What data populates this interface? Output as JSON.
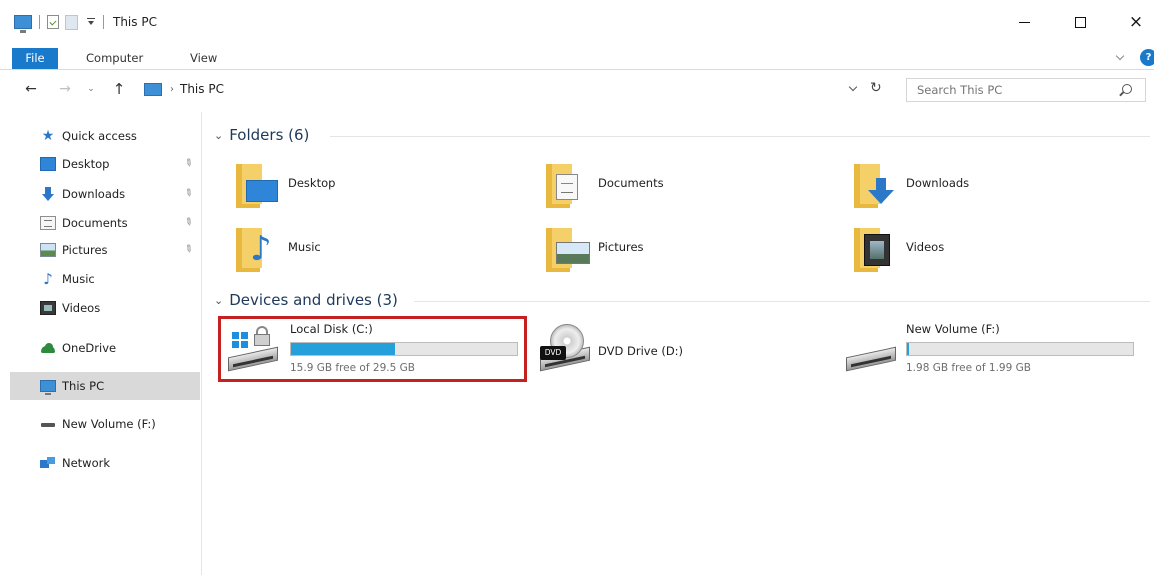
{
  "window": {
    "title": "This PC",
    "close_glyph": "×"
  },
  "ribbon": {
    "tabs": [
      {
        "label": "File",
        "active": true
      },
      {
        "label": "Computer",
        "active": false
      },
      {
        "label": "View",
        "active": false
      }
    ],
    "help_glyph": "?"
  },
  "navigation": {
    "back_glyph": "←",
    "forward_glyph": "→",
    "recent_glyph": "⌄",
    "up_glyph": "↑",
    "breadcrumb": [
      "This PC"
    ],
    "breadcrumb_separator": "›",
    "refresh_glyph": "↻",
    "search_placeholder": "Search This PC"
  },
  "sidebar": {
    "items": [
      {
        "label": "Quick access",
        "icon": "star-icon",
        "pinned": false,
        "selected": false
      },
      {
        "label": "Desktop",
        "icon": "desktop-icon",
        "pinned": true,
        "selected": false
      },
      {
        "label": "Downloads",
        "icon": "download-icon",
        "pinned": true,
        "selected": false
      },
      {
        "label": "Documents",
        "icon": "documents-icon",
        "pinned": true,
        "selected": false
      },
      {
        "label": "Pictures",
        "icon": "pictures-icon",
        "pinned": true,
        "selected": false
      },
      {
        "label": "Music",
        "icon": "music-icon",
        "pinned": false,
        "selected": false
      },
      {
        "label": "Videos",
        "icon": "videos-icon",
        "pinned": false,
        "selected": false
      },
      {
        "label": "OneDrive",
        "icon": "onedrive-icon",
        "pinned": false,
        "selected": false
      },
      {
        "label": "This PC",
        "icon": "this-pc-icon",
        "pinned": false,
        "selected": true
      },
      {
        "label": "New Volume (F:)",
        "icon": "drive-icon",
        "pinned": false,
        "selected": false
      },
      {
        "label": "Network",
        "icon": "network-icon",
        "pinned": false,
        "selected": false
      }
    ],
    "pin_glyph": "✎",
    "star_glyph": "★",
    "note_glyph": "♪"
  },
  "content": {
    "folders_header": "Folders (6)",
    "devices_header": "Devices and drives (3)",
    "collapse_glyph": "⌄",
    "folders": [
      {
        "label": "Desktop",
        "icon": "desktop-folder-icon"
      },
      {
        "label": "Documents",
        "icon": "documents-folder-icon"
      },
      {
        "label": "Downloads",
        "icon": "downloads-folder-icon"
      },
      {
        "label": "Music",
        "icon": "music-folder-icon"
      },
      {
        "label": "Pictures",
        "icon": "pictures-folder-icon"
      },
      {
        "label": "Videos",
        "icon": "videos-folder-icon"
      }
    ],
    "drives": [
      {
        "name": "Local Disk (C:)",
        "icon": "windows-drive-icon",
        "free_text": "15.9 GB free of 29.5 GB",
        "used_fraction": 0.46,
        "highlighted": true
      },
      {
        "name": "DVD Drive (D:)",
        "icon": "dvd-drive-icon",
        "badge": "DVD"
      },
      {
        "name": "New Volume (F:)",
        "icon": "usb-drive-icon",
        "free_text": "1.98 GB free of 1.99 GB",
        "used_fraction": 0.005
      }
    ]
  },
  "colors": {
    "accent": "#1979ca",
    "drive_bar_fill": "#26a0da",
    "highlight_border": "#c62121",
    "selection": "#d9d9d9"
  }
}
